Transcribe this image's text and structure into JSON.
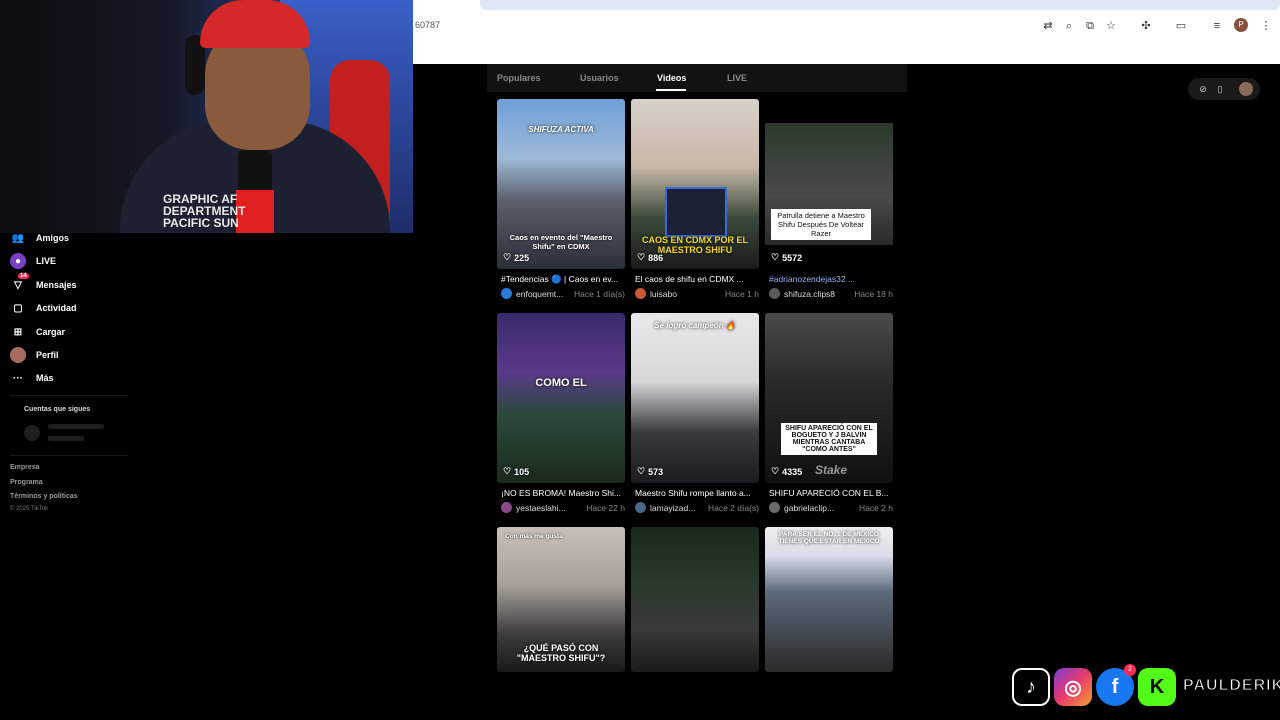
{
  "browser": {
    "url_fragment": "60787"
  },
  "webcam": {
    "shirt_text": "GRAPHIC AF DEPARTMENT PACIFIC SUN"
  },
  "sidebar": {
    "items": [
      {
        "label": "Amigos",
        "icon": "friends-icon"
      },
      {
        "label": "LIVE",
        "icon": "live-icon"
      },
      {
        "label": "Mensajes",
        "icon": "messages-icon",
        "badge": "14"
      },
      {
        "label": "Actividad",
        "icon": "activity-icon"
      },
      {
        "label": "Cargar",
        "icon": "upload-icon"
      },
      {
        "label": "Perfil",
        "icon": "profile-avatar"
      },
      {
        "label": "Más",
        "icon": "more-icon"
      }
    ],
    "following_title": "Cuentas que sigues",
    "footer_links": [
      "Empresa",
      "Programa",
      "Términos y políticas"
    ],
    "copyright": "© 2025 TikTok"
  },
  "search_tabs": [
    {
      "label": "Populares",
      "active": false
    },
    {
      "label": "Usuarios",
      "active": false
    },
    {
      "label": "Videos",
      "active": true
    },
    {
      "label": "LIVE",
      "active": false
    }
  ],
  "videos": [
    {
      "likes": "225",
      "caption": "#Tendencias 🔵 | Caos en ev...",
      "author": "enfoquemt...",
      "time": "Hace 1 día(s)",
      "overlay_top": "SHIFUZA ACTIVA",
      "overlay_bottom": "Caos en evento del \"Maestro Shifu\" en CDMX"
    },
    {
      "likes": "886",
      "caption": "El caos de shifu en CDMX ...",
      "author": "luisabo",
      "time": "Hace 1 h",
      "overlay_bottom": "CAOS EN CDMX POR EL MAESTRO SHIFU"
    },
    {
      "likes": "5572",
      "caption": "#adrianozendejas32 ...",
      "author": "shifuza.clips8",
      "time": "Hace 18 h",
      "overlay_mid": "Patrulla detiene a Maestro Shifu Después De Voltear Razer"
    },
    {
      "likes": "105",
      "caption": "¡NO ES BROMA! Maestro Shi...",
      "author": "yestaeslahi...",
      "time": "Hace 22 h",
      "overlay_mid": "COMO EL"
    },
    {
      "likes": "573",
      "caption": "Maestro Shifu rompe llanto a...",
      "author": "lamayizad...",
      "time": "Hace 2 día(s)",
      "overlay_top": "Se logró campeón 🔥"
    },
    {
      "likes": "4335",
      "caption": "SHIFU APARECIÓ CON EL B...",
      "author": "gabrielaclip...",
      "time": "Hace 2 h",
      "overlay_mid": "SHIFU APARECIÓ CON EL BOGUETO Y J BALVIN MIENTRAS CANTABA \"COMO ANTES\"",
      "watermark": "Stake"
    },
    {
      "overlay_top": "Con más me gusta",
      "overlay_bottom": "¿QUÉ PASÓ CON \"MAESTRO SHIFU\"?"
    },
    {},
    {
      "overlay_top": "PARA SER EL NO. 1 DE MEXICO TIENES QUE ESTAR EN MEXICO"
    }
  ],
  "social": {
    "brand": "PAULDERIK",
    "icons": [
      "tiktok-icon",
      "instagram-icon",
      "facebook-icon",
      "kick-icon"
    ],
    "notification": "2"
  },
  "colors": {
    "accent": "#fe2c55",
    "background": "#000000",
    "hashtag": "#8ab4f8"
  }
}
